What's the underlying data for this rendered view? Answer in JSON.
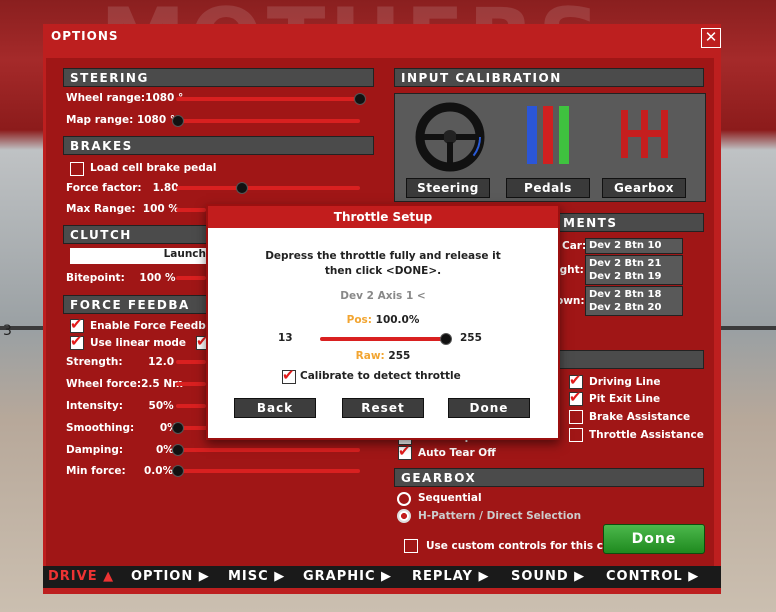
{
  "background": {
    "banner_text": "MOTHERS",
    "side_number": "3"
  },
  "window": {
    "title": "OPTIONS",
    "close_glyph": "✕"
  },
  "steering": {
    "header": "STEERING",
    "wheel_range_label": "Wheel range:",
    "wheel_range_value": "1080 °",
    "wheel_range_fraction": 1.0,
    "map_range_label": "Map range:",
    "map_range_value": "1080 °",
    "map_range_fraction": 0.0
  },
  "brakes": {
    "header": "BRAKES",
    "loadcell_label": "Load cell brake pedal",
    "force_factor_label": "Force factor:",
    "force_factor_value": "1.80",
    "force_factor_fraction": 0.4,
    "max_range_label": "Max Range:",
    "max_range_value": "100 %"
  },
  "clutch": {
    "header": "CLUTCH",
    "launch_label": "Launch",
    "bitepoint_label": "Bitepoint:",
    "bitepoint_value": "100 %"
  },
  "ffb": {
    "header": "FORCE FEEDBA",
    "enable_label": "Enable Force Feedbac",
    "linear_label": "Use linear mode",
    "strength_label": "Strength:",
    "strength_value": "12.0",
    "wheel_force_label": "Wheel force:",
    "wheel_force_value": "2.5 Nm",
    "intensity_label": "Intensity:",
    "intensity_value": "50%",
    "smoothing_label": "Smoothing:",
    "smoothing_value": "0%",
    "damping_label": "Damping:",
    "damping_value": "0%",
    "min_force_label": "Min force:",
    "min_force_value": "0.0%"
  },
  "input_calibration": {
    "header": "INPUT CALIBRATION",
    "steering_btn": "Steering",
    "pedals_btn": "Pedals",
    "gearbox_btn": "Gearbox"
  },
  "assignments": {
    "header": "MENTS",
    "rows": [
      {
        "label": "Car:",
        "values": [
          "Dev 2 Btn 10"
        ]
      },
      {
        "label": "ight:",
        "values": [
          "Dev 2 Btn 21",
          "Dev 2 Btn 19"
        ]
      },
      {
        "label": "own:",
        "values": [
          "Dev 2 Btn 18",
          "Dev 2 Btn 20"
        ]
      }
    ]
  },
  "aids": {
    "driving_line": "Driving Line",
    "pit_exit_line": "Pit Exit Line",
    "brake_assist": "Brake Assistance",
    "throttle_assist": "Throttle Assistance",
    "auto_wipers": "Auto Wipers",
    "auto_tear_off": "Auto Tear Off"
  },
  "gearbox": {
    "header": "GEARBOX",
    "sequential": "Sequential",
    "hpattern": "H-Pattern / Direct Selection",
    "custom_controls": "Use custom controls for this car"
  },
  "done_label": "Done",
  "nav": [
    {
      "label": "DRIVE ▲",
      "active": true
    },
    {
      "label": "OPTION ▶"
    },
    {
      "label": "MISC ▶"
    },
    {
      "label": "GRAPHIC ▶"
    },
    {
      "label": "REPLAY ▶"
    },
    {
      "label": "SOUND ▶"
    },
    {
      "label": "CONTROL ▶"
    }
  ],
  "dialog": {
    "title": "Throttle Setup",
    "line1": "Depress the throttle fully and release it",
    "line2": "then click <DONE>.",
    "axis": "Dev 2 Axis 1 <",
    "pos_label": "Pos:",
    "pos_value": "100.0%",
    "min": "13",
    "max": "255",
    "pos_fraction": 1.0,
    "raw_label": "Raw:",
    "raw_value": "255",
    "calibrate_label": "Calibrate to detect throttle",
    "back": "Back",
    "reset": "Reset",
    "done": "Done",
    "accent_color": "#f2a531"
  }
}
